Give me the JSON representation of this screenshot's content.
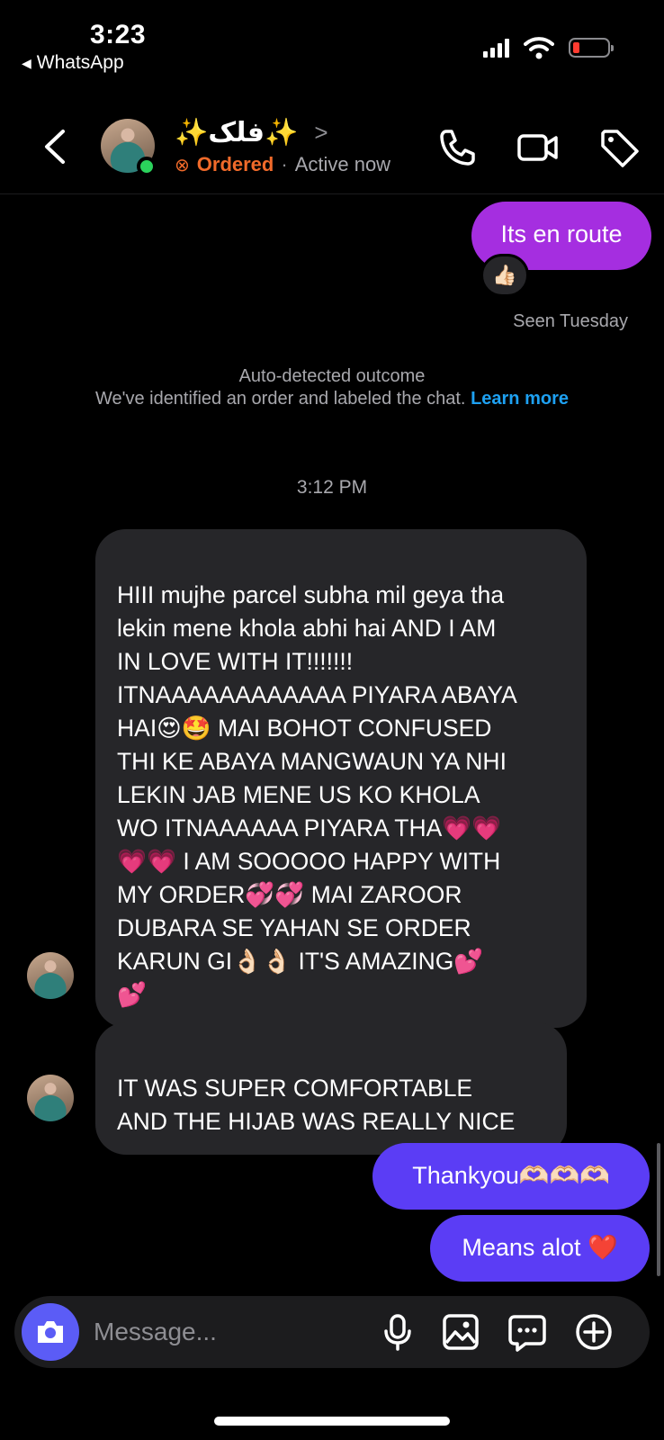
{
  "status_bar": {
    "time": "3:23",
    "back_app": "WhatsApp"
  },
  "header": {
    "name": "✨فلک✨",
    "chevron": ">",
    "status_label": "Ordered",
    "separator": "·",
    "presence": "Active now"
  },
  "messages": [
    {
      "id": "m1",
      "direction": "outgoing",
      "text": "Its en route",
      "reaction": "👍🏻"
    },
    {
      "id": "m2",
      "direction": "incoming",
      "text": "HIII mujhe parcel subha mil geya tha\nlekin mene khola abhi hai AND I AM\nIN LOVE WITH IT!!!!!!!\nITNAAAAAAAAAAAA PIYARA ABAYA\nHAI😍🤩 MAI BOHOT CONFUSED\nTHI KE ABAYA MANGWAUN YA NHI\nLEKIN JAB MENE US KO KHOLA\nWO ITNAAAAAA PIYARA THA💗💗\n💗💗 I AM SOOOOO HAPPY WITH\nMY ORDER💞💞 MAI ZAROOR\nDUBARA SE YAHAN SE ORDER\nKARUN GI👌🏻👌🏻 IT'S AMAZING💕\n💕"
    },
    {
      "id": "m3",
      "direction": "incoming",
      "text": "IT WAS SUPER COMFORTABLE\nAND THE HIJAB WAS REALLY NICE"
    },
    {
      "id": "m4",
      "direction": "outgoing",
      "text": "Thankyou🫶🏻🫶🏻🫶🏻"
    },
    {
      "id": "m5",
      "direction": "outgoing",
      "text": "Means alot ❤️"
    }
  ],
  "seen_label": "Seen Tuesday",
  "system_note": {
    "title": "Auto-detected outcome",
    "body": "We've identified an order and labeled the chat.",
    "link": "Learn more"
  },
  "timestamp": "3:12 PM",
  "composer": {
    "placeholder": "Message..."
  },
  "colors": {
    "outgoing_first": "#a52ee0",
    "outgoing": "#5b3df5",
    "incoming": "#262629",
    "ordered": "#f06a2a",
    "link": "#1ea1f2",
    "online": "#2bd25c"
  },
  "icons": [
    "back-arrow-icon",
    "location-arrow-icon",
    "signal-icon",
    "wifi-icon",
    "battery-icon",
    "chevron-left-icon",
    "phone-icon",
    "video-camera-icon",
    "tag-icon",
    "camera-icon",
    "microphone-icon",
    "gallery-icon",
    "sticker-icon",
    "plus-circle-icon"
  ]
}
